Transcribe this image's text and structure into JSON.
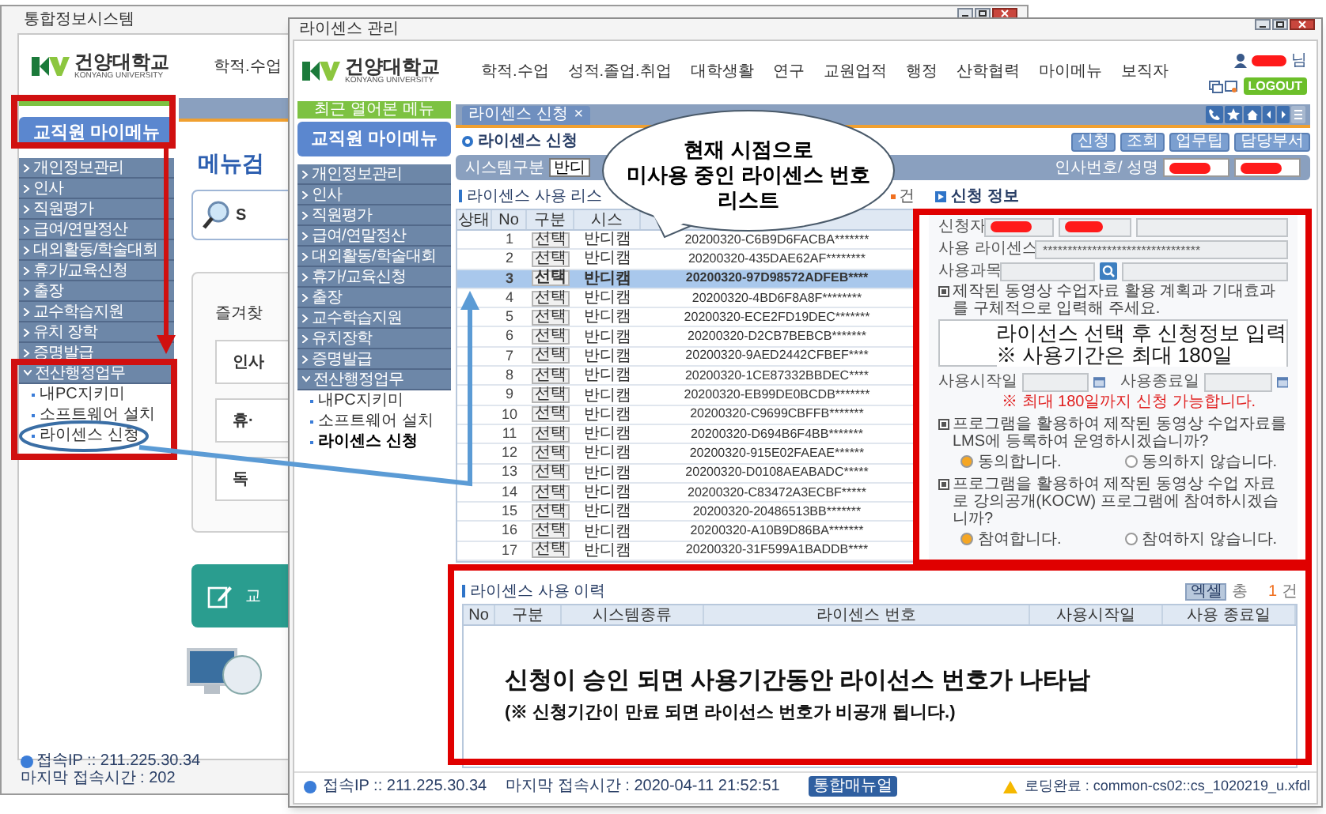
{
  "background_window": {
    "title": "통합정보시스템",
    "logo": {
      "name": "건양대학교",
      "subtitle": "KONYANG UNIVERSITY"
    },
    "nav": [
      "학적.수업"
    ],
    "menu_button": "교직원 마이메뉴",
    "menu": [
      {
        "label": "개인정보관리",
        "expanded": false
      },
      {
        "label": "인사",
        "expanded": false
      },
      {
        "label": "직원평가",
        "expanded": false
      },
      {
        "label": "급여/연말정산",
        "expanded": false
      },
      {
        "label": "대외활동/학술대회",
        "expanded": false
      },
      {
        "label": "휴가/교육신청",
        "expanded": false
      },
      {
        "label": "출장",
        "expanded": false
      },
      {
        "label": "교수학습지원",
        "expanded": false
      },
      {
        "label": "유치 장학",
        "expanded": false
      },
      {
        "label": "증명발급",
        "expanded": false
      },
      {
        "label": "전산행정업무",
        "expanded": true,
        "children": [
          {
            "label": "내PC지키미",
            "selected": false
          },
          {
            "label": "소프트웨어 설치",
            "selected": false
          },
          {
            "label": "라이센스 신청",
            "selected": false
          }
        ]
      }
    ],
    "main": {
      "heading": "메뉴검",
      "search_text": "S",
      "favorites_title": "즐겨찾",
      "shortcuts": [
        "인사",
        "휴·",
        "독"
      ],
      "banner": "교"
    },
    "footer": {
      "ip": "접속IP :: 211.225.30.34",
      "last_access": "마지막 접속시간 : 202"
    }
  },
  "window": {
    "title": "라이센스 관리",
    "logo": {
      "name": "건양대학교",
      "subtitle": "KONYANG UNIVERSITY"
    },
    "nav": [
      "학적.수업",
      "성적.졸업.취업",
      "대학생활",
      "연구",
      "교원업적",
      "행정",
      "산학협력",
      "마이메뉴",
      "보직자"
    ],
    "user_suffix": "님",
    "logout": "LOGOUT",
    "recent_menu": "최근 열어본 메뉴",
    "menu_button": "교직원 마이메뉴",
    "menu": [
      {
        "label": "개인정보관리",
        "expanded": false
      },
      {
        "label": "인사",
        "expanded": false
      },
      {
        "label": "직원평가",
        "expanded": false
      },
      {
        "label": "급여/연말정산",
        "expanded": false
      },
      {
        "label": "대외활동/학술대회",
        "expanded": false
      },
      {
        "label": "휴가/교육신청",
        "expanded": false
      },
      {
        "label": "출장",
        "expanded": false
      },
      {
        "label": "교수학습지원",
        "expanded": false
      },
      {
        "label": "유치장학",
        "expanded": false
      },
      {
        "label": "증명발급",
        "expanded": false
      },
      {
        "label": "전산행정업무",
        "expanded": true,
        "children": [
          {
            "label": "내PC지키미",
            "selected": false
          },
          {
            "label": "소프트웨어 설치",
            "selected": false
          },
          {
            "label": "라이센스 신청",
            "selected": true
          }
        ]
      }
    ],
    "tab": {
      "label": "라이센스 신청",
      "close": "×"
    },
    "page_title": "라이센스 신청",
    "actions": [
      "신청",
      "조회",
      "업무팁",
      "담당부서"
    ],
    "filter": {
      "system_label": "시스템구분",
      "system_value": "반디",
      "person_label": "인사번호/ 성명"
    },
    "license_list": {
      "title": "라이센스 사용 리스",
      "count": "건",
      "columns": [
        "상태",
        "No",
        "구분",
        "시스"
      ],
      "rows": [
        {
          "no": "1",
          "action": "선택",
          "system": "반디캠",
          "license": "20200320-C6B9D6FACBA*******",
          "selected": false
        },
        {
          "no": "2",
          "action": "선택",
          "system": "반디캠",
          "license": "20200320-435DAE62AF********",
          "selected": false
        },
        {
          "no": "3",
          "action": "선택",
          "system": "반디캠",
          "license": "20200320-97D98572ADFEB****",
          "selected": true
        },
        {
          "no": "4",
          "action": "선택",
          "system": "반디캠",
          "license": "20200320-4BD6F8A8F********",
          "selected": false
        },
        {
          "no": "5",
          "action": "선택",
          "system": "반디캠",
          "license": "20200320-ECE2FD19DEC*******",
          "selected": false
        },
        {
          "no": "6",
          "action": "선택",
          "system": "반디캠",
          "license": "20200320-D2CB7BEBCB*******",
          "selected": false
        },
        {
          "no": "7",
          "action": "선택",
          "system": "반디캠",
          "license": "20200320-9AED2442CFBEF****",
          "selected": false
        },
        {
          "no": "8",
          "action": "선택",
          "system": "반디캠",
          "license": "20200320-1CE87332BBDEC****",
          "selected": false
        },
        {
          "no": "9",
          "action": "선택",
          "system": "반디캠",
          "license": "20200320-EB99DE0BCDB*******",
          "selected": false
        },
        {
          "no": "10",
          "action": "선택",
          "system": "반디캠",
          "license": "20200320-C9699CBFFB*******",
          "selected": false
        },
        {
          "no": "11",
          "action": "선택",
          "system": "반디캠",
          "license": "20200320-D694B6F4BB*******",
          "selected": false
        },
        {
          "no": "12",
          "action": "선택",
          "system": "반디캠",
          "license": "20200320-915E02FAEAE******",
          "selected": false
        },
        {
          "no": "13",
          "action": "선택",
          "system": "반디캠",
          "license": "20200320-D0108AEABADC*****",
          "selected": false
        },
        {
          "no": "14",
          "action": "선택",
          "system": "반디캠",
          "license": "20200320-C83472A3ECBF*****",
          "selected": false
        },
        {
          "no": "15",
          "action": "선택",
          "system": "반디캠",
          "license": "20200320-20486513BB*******",
          "selected": false
        },
        {
          "no": "16",
          "action": "선택",
          "system": "반디캠",
          "license": "20200320-A10B9D86BA*******",
          "selected": false
        },
        {
          "no": "17",
          "action": "선택",
          "system": "반디캠",
          "license": "20200320-31F599A1BADDB****",
          "selected": false
        }
      ]
    },
    "request_form": {
      "title": "신청 정보",
      "applicant_label": "신청자",
      "license_label": "사용 라이센스",
      "license_value": "********************************",
      "course_label": "사용과목",
      "plan_prompt": "제작된 동영상 수업자료 활용 계획과 기대효과를 구체적으로 입력해 주세요.",
      "start_label": "사용시작일",
      "end_label": "사용종료일",
      "period_note": "※ 최대 180일까지 신청 가능합니다.",
      "questions": [
        {
          "text": "프로그램을 활용하여 제작된 동영상 수업자료를 LMS에 등록하여 운영하시겠습니까?",
          "options": [
            {
              "label": "동의합니다.",
              "selected": true
            },
            {
              "label": "동의하지 않습니다.",
              "selected": false
            }
          ]
        },
        {
          "text": "프로그램을 활용하여 제작된 동영상 수업 자료로 강의공개(KOCW) 프로그램에 참여하시겠습니까?",
          "options": [
            {
              "label": "참여합니다.",
              "selected": true
            },
            {
              "label": "참여하지 않습니다.",
              "selected": false
            }
          ]
        }
      ]
    },
    "history": {
      "title": "라이센스 사용 이력",
      "excel": "엑셀",
      "total_label": "총",
      "count": "1",
      "count_unit": "건",
      "columns": [
        "No",
        "구분",
        "시스템종류",
        "라이센스 번호",
        "사용시작일",
        "사용 종료일"
      ]
    },
    "footer": {
      "ip": "접속IP :: 211.225.30.34",
      "last_access": "마지막 접속시간 : 2020-04-11 21:52:51",
      "manual": "통합매뉴얼",
      "status": "로딩완료 : common-cs02::cs_1020219_u.xfdl"
    }
  },
  "annotations": {
    "callout": [
      "현재 시점으로",
      "미사용 중인 라이센스 번호",
      "리스트"
    ],
    "form_note": [
      "라이선스 선택 후 신청정보 입력",
      "※ 사용기간은 최대 180일"
    ],
    "history_note": {
      "main": "신청이 승인 되면 사용기간동안 라이선스 번호가 나타남",
      "sub": "(※ 신청기간이 만료 되면 라이선스 번호가 비공개 됩니다.)"
    }
  }
}
